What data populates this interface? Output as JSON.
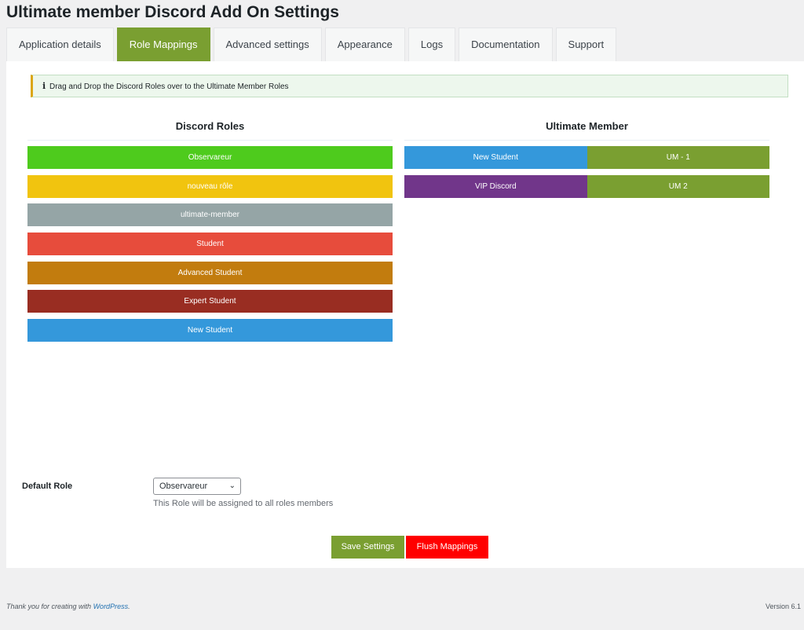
{
  "page": {
    "title": "Ultimate member Discord Add On Settings"
  },
  "tabs": [
    {
      "label": "Application details",
      "active": false
    },
    {
      "label": "Role Mappings",
      "active": true
    },
    {
      "label": "Advanced settings",
      "active": false
    },
    {
      "label": "Appearance",
      "active": false
    },
    {
      "label": "Logs",
      "active": false
    },
    {
      "label": "Documentation",
      "active": false
    },
    {
      "label": "Support",
      "active": false
    }
  ],
  "notice": {
    "icon": "info-icon",
    "text": "Drag and Drop the Discord Roles over to the Ultimate Member Roles"
  },
  "discord": {
    "title": "Discord Roles",
    "roles": [
      {
        "label": "Observareur",
        "color": "#4ecb1d"
      },
      {
        "label": "nouveau rôle",
        "color": "#f1c40f"
      },
      {
        "label": "ultimate-member",
        "color": "#95a5a6"
      },
      {
        "label": "Student",
        "color": "#e74c3c"
      },
      {
        "label": "Advanced Student",
        "color": "#c27c0e"
      },
      {
        "label": "Expert Student",
        "color": "#992d22"
      },
      {
        "label": "New Student",
        "color": "#3498db"
      }
    ]
  },
  "um": {
    "title": "Ultimate Member",
    "mappings": [
      {
        "discord": "New Student",
        "discord_color": "#3498db",
        "um": "UM - 1",
        "um_color": "#7a9f31"
      },
      {
        "discord": "VIP Discord",
        "discord_color": "#71368a",
        "um": "UM 2",
        "um_color": "#7a9f31"
      }
    ]
  },
  "default_role": {
    "label": "Default Role",
    "selected": "Observareur",
    "hint": "This Role will be assigned to all roles members"
  },
  "buttons": {
    "save": "Save Settings",
    "flush": "Flush Mappings"
  },
  "footer": {
    "prefix": "Thank you for creating with ",
    "link": "WordPress",
    "suffix": ".",
    "version": "Version 6.1"
  },
  "colors": {
    "accent": "#7a9f31",
    "danger": "#ff0000"
  }
}
